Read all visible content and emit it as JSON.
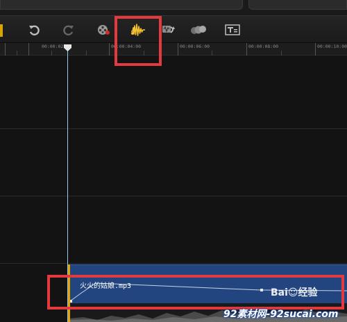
{
  "toolbar": {
    "buttons": [
      {
        "name": "undo-button",
        "icon": "undo-icon"
      },
      {
        "name": "redo-button",
        "icon": "redo-icon"
      },
      {
        "name": "mix-button",
        "icon": "film-reel-icon"
      },
      {
        "name": "audio-mixing-button",
        "icon": "audio-waveform-icon"
      },
      {
        "name": "audio-sync-button",
        "icon": "audio-sync-icon"
      },
      {
        "name": "color-effect-button",
        "icon": "circles-icon"
      },
      {
        "name": "title-button",
        "icon": "title-icon"
      }
    ],
    "accent_color": "#d8a500",
    "active_icon_color": "#f2c230"
  },
  "ruler": {
    "labels": [
      "00:00:02:00",
      "00:00:04:00",
      "00:00:06:00",
      "00:00:08:00",
      "00:00:10:00"
    ]
  },
  "audio_clip": {
    "name": "火火的姑娘.mp3",
    "color": "#23457f"
  },
  "highlight_color": "#e23a3f",
  "watermarks": {
    "baidu": "Bai☺经验",
    "site": "92素材网-92sucai.com"
  }
}
